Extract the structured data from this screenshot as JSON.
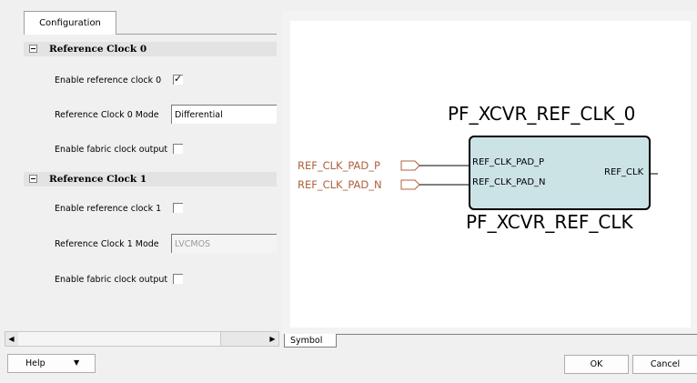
{
  "config_tab": {
    "label": "Configuration"
  },
  "sections": [
    {
      "title": "Reference Clock 0",
      "enable_label": "Enable reference clock 0",
      "enable_checked": true,
      "mode_label": "Reference Clock 0 Mode",
      "mode_value": "Differential",
      "fabric_label": "Enable fabric clock output",
      "fabric_checked": false
    },
    {
      "title": "Reference Clock 1",
      "enable_label": "Enable reference clock 1",
      "enable_checked": false,
      "mode_label": "Reference Clock 1 Mode",
      "mode_value": "LVCMOS",
      "fabric_label": "Enable fabric clock output",
      "fabric_checked": false
    }
  ],
  "symbol": {
    "tab_label": "Symbol",
    "instance_name": "PF_XCVR_REF_CLK_0",
    "component_name": "PF_XCVR_REF_CLK",
    "input_ports": [
      "REF_CLK_PAD_P",
      "REF_CLK_PAD_N"
    ],
    "inner_pins": [
      "REF_CLK_PAD_P",
      "REF_CLK_PAD_N"
    ],
    "output_pin": "REF_CLK",
    "box_color": "#cce3e6",
    "port_color": "#b0603c"
  },
  "buttons": {
    "help": "Help",
    "ok": "OK",
    "cancel": "Cancel"
  }
}
